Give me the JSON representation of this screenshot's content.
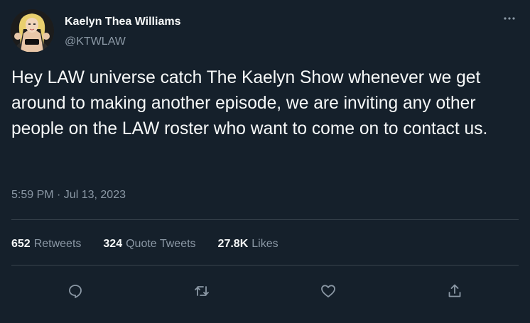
{
  "author": {
    "display_name": "Kaelyn Thea Williams",
    "handle": "@KTWLAW",
    "avatar_icon": "profile-photo"
  },
  "tweet": {
    "text": "Hey LAW universe catch The Kaelyn Show whenever we get around to making another episode, we are inviting any other people on the LAW roster who want to come on to contact us.",
    "timestamp": "5:59 PM · Jul 13, 2023"
  },
  "stats": {
    "retweets": {
      "count": "652",
      "label": "Retweets"
    },
    "quote_tweets": {
      "count": "324",
      "label": "Quote Tweets"
    },
    "likes": {
      "count": "27.8K",
      "label": "Likes"
    }
  },
  "actions": {
    "reply_icon": "reply-icon",
    "retweet_icon": "retweet-icon",
    "like_icon": "heart-icon",
    "share_icon": "share-icon"
  },
  "colors": {
    "background": "#15202b",
    "primary_text": "#f7f9f9",
    "secondary_text": "#8b98a5",
    "divider": "#38444d"
  }
}
